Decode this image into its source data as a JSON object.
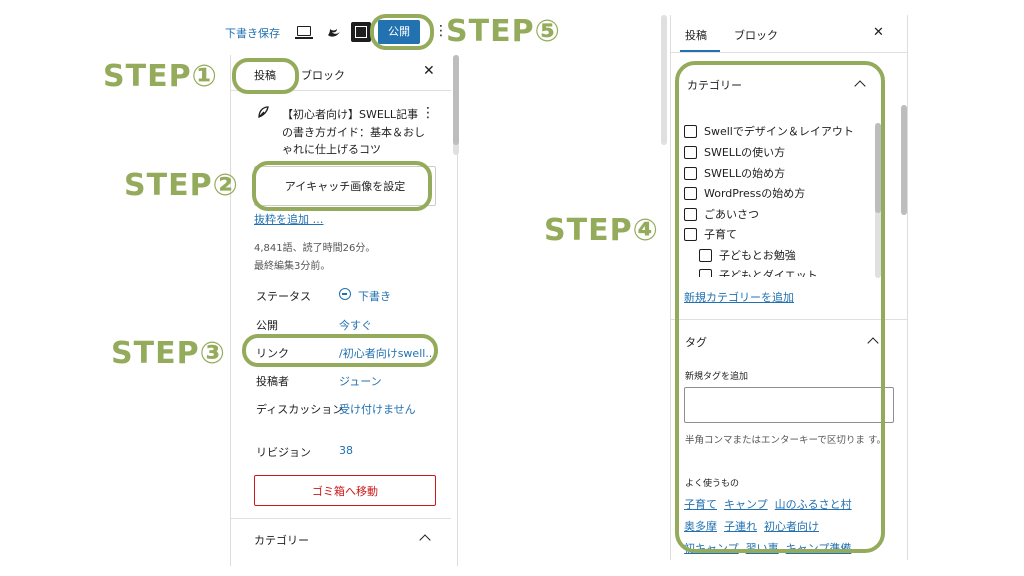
{
  "toolbar": {
    "save_draft": "下書き保存",
    "publish": "公開"
  },
  "steps": {
    "s1": "STEP①",
    "s2": "STEP②",
    "s3": "STEP③",
    "s4": "STEP④",
    "s5": "STEP⑤"
  },
  "left_panel": {
    "tab_post": "投稿",
    "tab_block": "ブロック",
    "post_title_1": "【初心者向け】SWELL記事",
    "post_title_2": "の書き方ガイド：基本＆おし",
    "post_title_3": "ゃれに仕上げるコツ",
    "featured_image": "アイキャッチ画像を設定",
    "add_excerpt": "抜粋を追加 …",
    "word_count": "4,841語、読了時間26分。",
    "last_edited": "最終編集3分前。",
    "meta": [
      {
        "label": "ステータス",
        "value": "下書き"
      },
      {
        "label": "公開",
        "value": "今すぐ"
      },
      {
        "label": "リンク",
        "value": "/初心者向けswell..."
      },
      {
        "label": "投稿者",
        "value": "ジューン"
      },
      {
        "label": "ディスカッション",
        "value": "受け付けません"
      },
      {
        "label": "リビジョン",
        "value": "38"
      }
    ],
    "trash": "ゴミ箱へ移動",
    "category_header": "カテゴリー"
  },
  "right_panel": {
    "tab_post": "投稿",
    "tab_block": "ブロック",
    "category_header": "カテゴリー",
    "categories": [
      "Swellでデザイン＆レイアウト",
      "SWELLの使い方",
      "SWELLの始め方",
      "WordPressの始め方",
      "ごあいさつ",
      "子育て",
      "子どもとお勉強",
      "子どもとダイエット"
    ],
    "add_category": "新規カテゴリーを追加",
    "tag_header": "タグ",
    "add_tag_label": "新規タグを追加",
    "tag_help": "半角コンマまたはエンターキーで区切りま す。",
    "frequent_label": "よく使うもの",
    "tags_row1": [
      "子育て",
      "キャンプ",
      "山のふるさと村"
    ],
    "tags_row2": [
      "奥多摩",
      "子連れ",
      "初心者向け"
    ],
    "tags_row3": [
      "初キャンプ",
      "習い事",
      "キャンプ準備"
    ]
  },
  "colors": {
    "accent_green": "#94ab5b",
    "wp_blue": "#2271b1",
    "danger_red": "#cc1818"
  }
}
